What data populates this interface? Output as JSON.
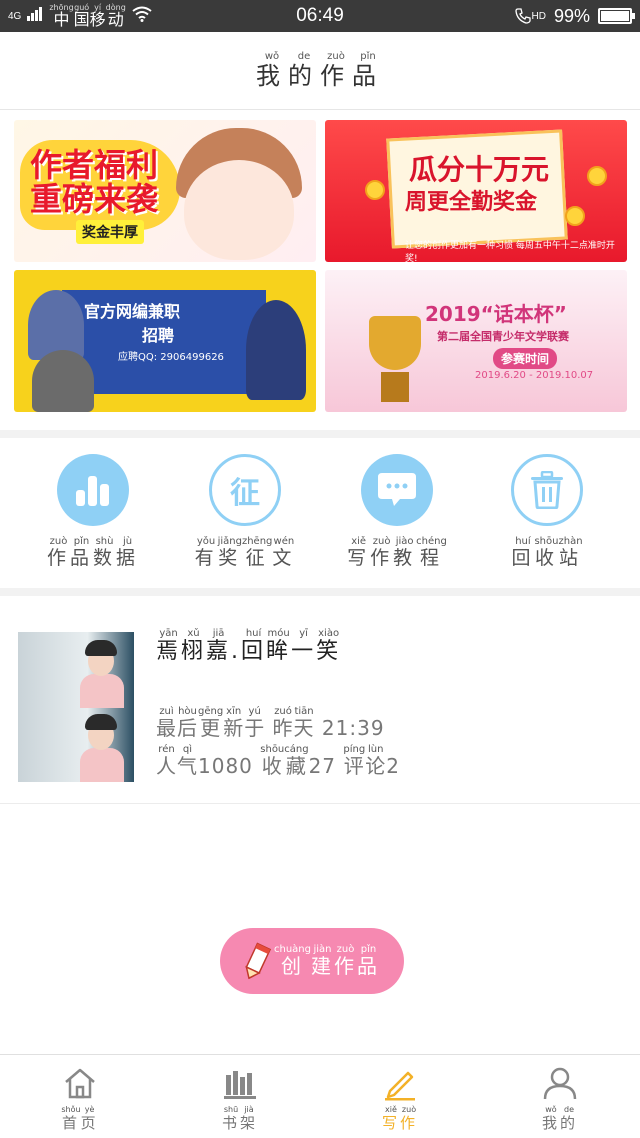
{
  "status_bar": {
    "network": "4G",
    "carrier": [
      {
        "char": "中",
        "pinyin": "zhōng"
      },
      {
        "char": "国",
        "pinyin": "guó"
      },
      {
        "char": "移",
        "pinyin": "yí"
      },
      {
        "char": "动",
        "pinyin": "dòng"
      }
    ],
    "time": "06:49",
    "hd": "HD",
    "battery": "99%",
    "battery_level": 0.99
  },
  "header": {
    "title": [
      {
        "char": "我",
        "pinyin": "wǒ"
      },
      {
        "char": "的",
        "pinyin": "de"
      },
      {
        "char": "作",
        "pinyin": "zuò"
      },
      {
        "char": "品",
        "pinyin": "pǐn"
      }
    ]
  },
  "banners": [
    {
      "line1": "作者福利",
      "line2": "重磅来袭",
      "tag": "奖金丰厚"
    },
    {
      "line1": "瓜分十万元",
      "line2": "周更全勤奖金",
      "note": "让您的创作更加有一种习惯 每周五中午十二点准时开奖!"
    },
    {
      "line1": "官方网编兼职",
      "line2": "招聘",
      "line3": "应聘QQ: 2906499626"
    },
    {
      "line1": "2019“话本杯”",
      "line2": "第二届全国青少年文学联赛",
      "line3": "参赛时间",
      "line4": "2019.6.20 - 2019.10.07"
    }
  ],
  "tools": [
    {
      "label": [
        {
          "char": "作",
          "pinyin": "zuò"
        },
        {
          "char": "品",
          "pinyin": "pǐn"
        },
        {
          "char": "数",
          "pinyin": "shù"
        },
        {
          "char": "据",
          "pinyin": "jù"
        }
      ],
      "icon": "bar-chart-icon"
    },
    {
      "label": [
        {
          "char": "有",
          "pinyin": "yǒu"
        },
        {
          "char": "奖",
          "pinyin": "jiǎng"
        },
        {
          "char": "征",
          "pinyin": "zhēng"
        },
        {
          "char": "文",
          "pinyin": "wén"
        }
      ],
      "icon": "contest-icon",
      "icon_text": "征"
    },
    {
      "label": [
        {
          "char": "写",
          "pinyin": "xiě"
        },
        {
          "char": "作",
          "pinyin": "zuò"
        },
        {
          "char": "教",
          "pinyin": "jiào"
        },
        {
          "char": "程",
          "pinyin": "chéng"
        }
      ],
      "icon": "chat-bubble-icon"
    },
    {
      "label": [
        {
          "char": "回",
          "pinyin": "huí"
        },
        {
          "char": "收",
          "pinyin": "shōu"
        },
        {
          "char": "站",
          "pinyin": "zhàn"
        }
      ],
      "icon": "trash-icon"
    }
  ],
  "work": {
    "title": [
      {
        "char": "焉",
        "pinyin": "yān"
      },
      {
        "char": "栩",
        "pinyin": "xǔ"
      },
      {
        "char": "嘉",
        "pinyin": "jiā"
      },
      {
        "char": ".",
        "pinyin": ""
      },
      {
        "char": "回",
        "pinyin": "huí"
      },
      {
        "char": "眸",
        "pinyin": "móu"
      },
      {
        "char": "一",
        "pinyin": "yī"
      },
      {
        "char": "笑",
        "pinyin": "xiào"
      }
    ],
    "updated": [
      {
        "char": "最",
        "pinyin": "zuì"
      },
      {
        "char": "后",
        "pinyin": "hòu"
      },
      {
        "char": "更",
        "pinyin": "gēng"
      },
      {
        "char": "新",
        "pinyin": "xīn"
      },
      {
        "char": "于",
        "pinyin": "yú"
      },
      {
        "char": " ",
        "pinyin": ""
      },
      {
        "char": "昨",
        "pinyin": "zuó"
      },
      {
        "char": "天",
        "pinyin": "tiān"
      },
      {
        "char": " 21:39",
        "pinyin": ""
      }
    ],
    "stats": [
      {
        "char": "人",
        "pinyin": "rén"
      },
      {
        "char": "气",
        "pinyin": "qì"
      },
      {
        "char": "1080 ",
        "pinyin": ""
      },
      {
        "char": "收",
        "pinyin": "shōu"
      },
      {
        "char": "藏",
        "pinyin": "cáng"
      },
      {
        "char": "27 ",
        "pinyin": ""
      },
      {
        "char": "评",
        "pinyin": "píng"
      },
      {
        "char": "论",
        "pinyin": "lùn"
      },
      {
        "char": "2",
        "pinyin": ""
      }
    ]
  },
  "create_button": {
    "label": [
      {
        "char": "创",
        "pinyin": "chuàng"
      },
      {
        "char": "建",
        "pinyin": "jiàn"
      },
      {
        "char": "作",
        "pinyin": "zuò"
      },
      {
        "char": "品",
        "pinyin": "pǐn"
      }
    ],
    "icon": "pencil-icon"
  },
  "tabbar": [
    {
      "label": [
        {
          "char": "首",
          "pinyin": "shǒu"
        },
        {
          "char": "页",
          "pinyin": "yè"
        }
      ],
      "icon": "home-icon",
      "active": false
    },
    {
      "label": [
        {
          "char": "书",
          "pinyin": "shū"
        },
        {
          "char": "架",
          "pinyin": "jià"
        }
      ],
      "icon": "bookshelf-icon",
      "active": false
    },
    {
      "label": [
        {
          "char": "写",
          "pinyin": "xiě"
        },
        {
          "char": "作",
          "pinyin": "zuò"
        }
      ],
      "icon": "pen-icon",
      "active": true
    },
    {
      "label": [
        {
          "char": "我",
          "pinyin": "wǒ"
        },
        {
          "char": "的",
          "pinyin": "de"
        }
      ],
      "icon": "user-icon",
      "active": false
    }
  ],
  "colors": {
    "accent_blue": "#8fd0f5",
    "create_pink": "#f689b1",
    "active_tab": "#f3b127"
  }
}
